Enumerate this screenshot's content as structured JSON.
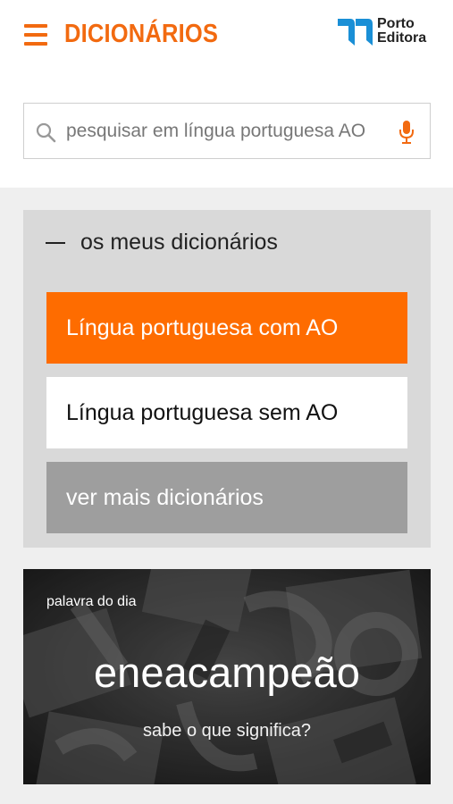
{
  "header": {
    "title": "DICIONÁRIOS",
    "menu_icon": "hamburger-menu-icon",
    "logo_line1": "Porto",
    "logo_line2": "Editora"
  },
  "search": {
    "placeholder": "pesquisar em língua portuguesa AO",
    "value": "",
    "search_icon": "search-icon",
    "mic_icon": "microphone-icon"
  },
  "my_dictionaries": {
    "title": "os meus dicionários",
    "items": [
      {
        "label": "Língua portuguesa com AO",
        "selected": true
      },
      {
        "label": "Língua portuguesa sem AO",
        "selected": false
      }
    ],
    "more_label": "ver mais dicionários"
  },
  "word_of_day": {
    "label": "palavra do dia",
    "word": "eneacampeão",
    "cta": "sabe o que significa?"
  },
  "colors": {
    "accent": "#fe6c00",
    "title_orange": "#f26a10",
    "panel_bg": "#d9d9d9",
    "more_button_bg": "#9e9e9e",
    "logo_blue": "#1a8fd6"
  }
}
